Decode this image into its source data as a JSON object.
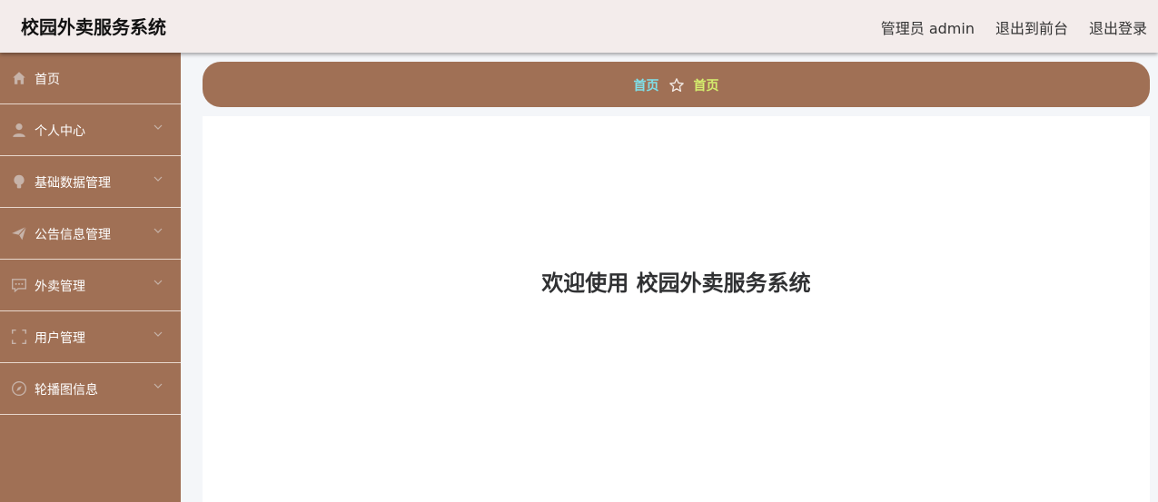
{
  "header": {
    "title": "校园外卖服务系统",
    "user_label": "管理员 admin",
    "to_front": "退出到前台",
    "logout": "退出登录"
  },
  "sidebar": {
    "items": [
      {
        "label": "首页",
        "icon": "home-icon"
      },
      {
        "label": "个人中心",
        "icon": "user-icon"
      },
      {
        "label": "基础数据管理",
        "icon": "bulb-icon"
      },
      {
        "label": "公告信息管理",
        "icon": "send-icon"
      },
      {
        "label": "外卖管理",
        "icon": "chat-icon"
      },
      {
        "label": "用户管理",
        "icon": "fullscreen-icon"
      },
      {
        "label": "轮播图信息",
        "icon": "compass-icon"
      }
    ]
  },
  "breadcrumb": {
    "home": "首页",
    "separator_icon": "star-icon",
    "current": "首页"
  },
  "main": {
    "welcome": "欢迎使用 校园外卖服务系统"
  },
  "colors": {
    "sidebar": "#a07055",
    "topbar": "#f3eceb",
    "crumb_home": "#7fe0ea",
    "crumb_current": "#d5ef6d"
  }
}
